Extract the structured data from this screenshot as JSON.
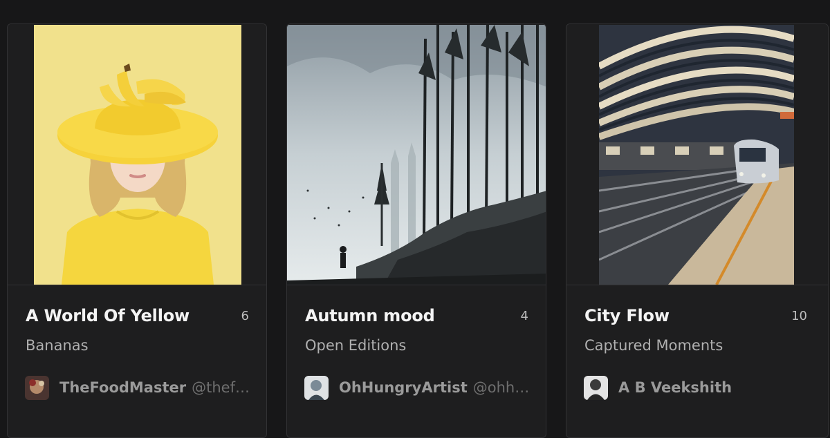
{
  "cards": [
    {
      "title": "A World Of Yellow",
      "count": "6",
      "subtitle": "Bananas",
      "creator_name": "TheFoodMaster",
      "creator_handle": "@thef…",
      "image_alt": "Girl in yellow sweater and yellow hat with bananas"
    },
    {
      "title": "Autumn mood",
      "count": "4",
      "subtitle": "Open Editions",
      "creator_name": "OhHungryArtist",
      "creator_handle": "@ohh…",
      "image_alt": "Misty forest watercolor with a lone figure"
    },
    {
      "title": "City Flow",
      "count": "10",
      "subtitle": "Captured Moments",
      "creator_name": "A B Veekshith",
      "creator_handle": "",
      "image_alt": "Metro train arriving at a curved station platform"
    }
  ],
  "colors": {
    "background": "#171718",
    "card": "#1e1e1f",
    "border": "#323234",
    "title": "#f4f4f4",
    "subtitle": "#b0b0b0"
  }
}
